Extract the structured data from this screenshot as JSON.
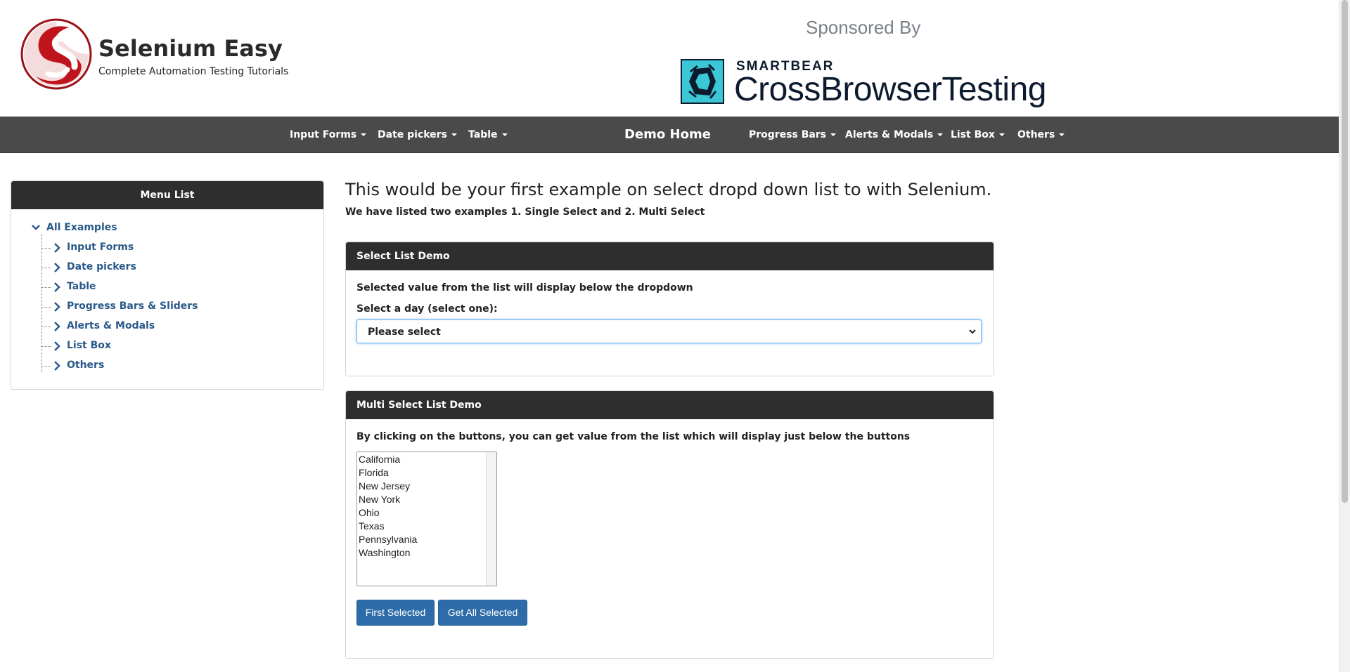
{
  "header": {
    "brand_title": "Selenium Easy",
    "brand_subtitle": "Complete Automation Testing Tutorials",
    "sponsor_label": "Sponsored By",
    "sponsor_small": "SMARTBEAR",
    "sponsor_big": "CrossBrowserTesting",
    "logo_icon": "selenium-easy-logo-icon",
    "sponsor_icon": "crossbrowsertesting-logo-icon"
  },
  "navbar": {
    "input_forms": "Input Forms",
    "date_pickers": "Date pickers",
    "table": "Table",
    "demo_home": "Demo Home",
    "progress_bars": "Progress Bars",
    "alerts_modals": "Alerts & Modals",
    "list_box": "List Box",
    "others": "Others"
  },
  "sidebar": {
    "title": "Menu List",
    "root": "All Examples",
    "items": [
      {
        "label": "Input Forms"
      },
      {
        "label": "Date pickers"
      },
      {
        "label": "Table"
      },
      {
        "label": "Progress Bars & Sliders"
      },
      {
        "label": "Alerts & Modals"
      },
      {
        "label": "List Box"
      },
      {
        "label": "Others"
      }
    ]
  },
  "main": {
    "title": "This would be your first example on select dropd down list to with Selenium.",
    "subtitle": "We have listed two examples 1. Single Select and 2. Multi Select"
  },
  "select_panel": {
    "heading": "Select List Demo",
    "description": "Selected value from the list will display below the dropdown",
    "label": "Select a day (select one):",
    "selected_value": "Please select"
  },
  "multi_panel": {
    "heading": "Multi Select List Demo",
    "description": "By clicking on the buttons, you can get value from the list which will display just below the buttons",
    "options": [
      "California",
      "Florida",
      "New Jersey",
      "New York",
      "Ohio",
      "Texas",
      "Pennsylvania",
      "Washington"
    ],
    "first_selected_button": "First Selected",
    "get_all_selected_button": "Get All Selected"
  },
  "colors": {
    "navbar_bg": "#4a4a4a",
    "panel_head_bg": "#2e2e2e",
    "link": "#2a5a8a",
    "button_bg": "#2d6ca8",
    "brand_red": "#c0141c",
    "sponsor_teal": "#3cc7d6"
  }
}
